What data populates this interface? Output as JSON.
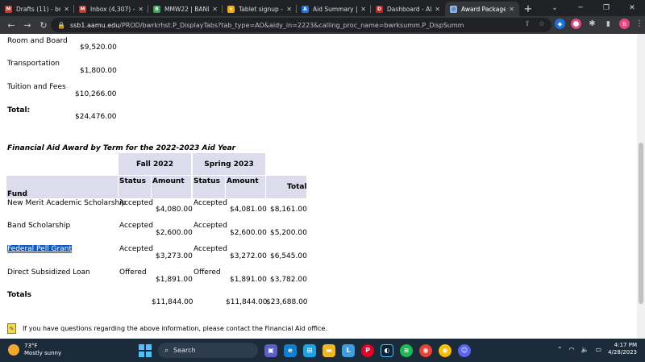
{
  "browser": {
    "tabs": [
      {
        "label": "Drafts (11) - bre",
        "favicon": "gmail-icon",
        "color": "#d93025",
        "glyph": "M"
      },
      {
        "label": "Inbox (4,307) - b",
        "favicon": "gmail-icon",
        "color": "#d93025",
        "glyph": "M"
      },
      {
        "label": "MMW22 | BAND",
        "favicon": "band-icon",
        "color": "#34a853",
        "glyph": "B"
      },
      {
        "label": "Tablet signup - M",
        "favicon": "pin-icon",
        "color": "#f9ab00",
        "glyph": "★"
      },
      {
        "label": "Aid Summary | G",
        "favicon": "aamu-icon",
        "color": "#1a73e8",
        "glyph": "A"
      },
      {
        "label": "Dashboard - Ala",
        "favicon": "dashboard-icon",
        "color": "#c5221f",
        "glyph": "D"
      },
      {
        "label": "Award Package 6",
        "favicon": "globe-icon",
        "color": "#8ab4f8",
        "glyph": "◎",
        "active": true
      }
    ],
    "url_host": "ssb1.aamu.edu",
    "url_path": "/PROD/bwrkrhst.P_DisplayTabs?tab_type=AO&aidy_in=2223&calling_proc_name=bwrksumm.P_DispSumm"
  },
  "costs": {
    "room_label": "Room and Board",
    "room_value": "$9,520.00",
    "transport_label": "Transportation",
    "transport_value": "$1,800.00",
    "tuition_label": "Tuition and Fees",
    "tuition_value": "$10,266.00",
    "total_label": "Total:",
    "total_value": "$24,476.00"
  },
  "aid": {
    "title": "Financial Aid Award by Term for the 2022-2023 Aid Year",
    "term1": "Fall 2022",
    "term2": "Spring 2023",
    "col_status": "Status",
    "col_amount": "Amount",
    "col_total": "Total",
    "col_fund": "Fund",
    "rows": [
      {
        "fund": "New Merit Academic Scholarship",
        "s1": "Accepted",
        "a1": "$4,080.00",
        "s2": "Accepted",
        "a2": "$4,081.00",
        "total": "$8,161.00"
      },
      {
        "fund": "Band Scholarship",
        "s1": "Accepted",
        "a1": "$2,600.00",
        "s2": "Accepted",
        "a2": "$2,600.00",
        "total": "$5,200.00"
      },
      {
        "fund": "Federal Pell Grant",
        "s1": "Accepted",
        "a1": "$3,273.00",
        "s2": "Accepted",
        "a2": "$3,272.00",
        "total": "$6,545.00"
      },
      {
        "fund": "Direct Subsidized Loan",
        "s1": "Offered",
        "a1": "$1,891.00",
        "s2": "Offered",
        "a2": "$1,891.00",
        "total": "$3,782.00"
      }
    ],
    "totals_label": "Totals",
    "totals_a1": "$11,844.00",
    "totals_a2": "$11,844.00",
    "totals_total": "$23,688.00",
    "info_text": "If you have questions regarding the above information, please contact the Financial Aid office."
  },
  "taskbar": {
    "temp": "73°F",
    "weather": "Mostly sunny",
    "search_label": "Search",
    "time": "4:17 PM",
    "date": "4/28/2023"
  }
}
